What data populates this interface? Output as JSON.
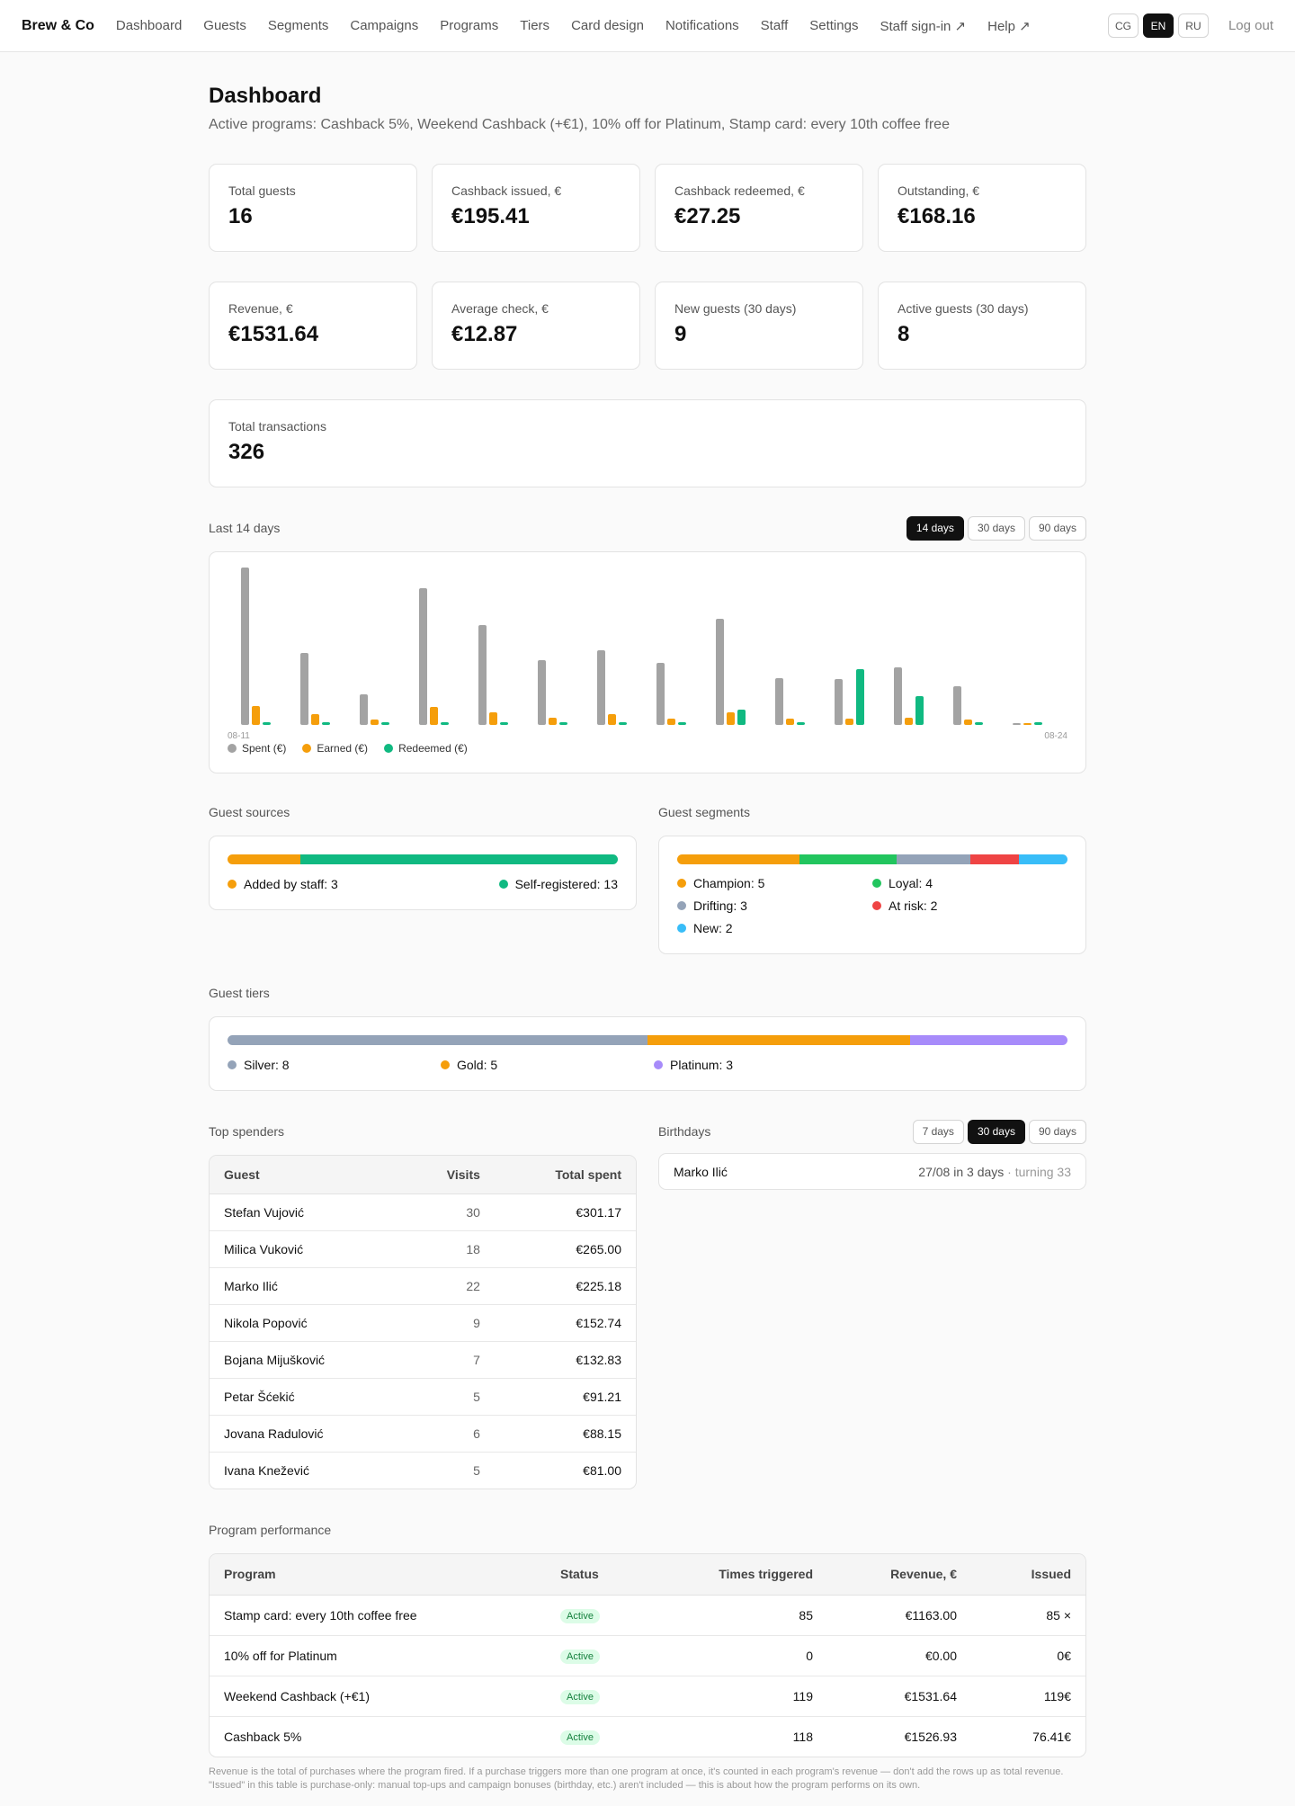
{
  "nav": {
    "brand": "Brew & Co",
    "items": [
      "Dashboard",
      "Guests",
      "Segments",
      "Campaigns",
      "Programs",
      "Tiers",
      "Card design",
      "Notifications",
      "Staff",
      "Settings",
      "Staff sign-in ↗",
      "Help ↗"
    ],
    "languages": [
      "CG",
      "EN",
      "RU"
    ],
    "active_language": "EN",
    "logout": "Log out"
  },
  "page": {
    "title": "Dashboard",
    "subtitle": "Active programs: Cashback 5%, Weekend Cashback (+€1), 10% off for Platinum, Stamp card: every 10th coffee free"
  },
  "stats": [
    {
      "label": "Total guests",
      "value": "16"
    },
    {
      "label": "Cashback issued, €",
      "value": "€195.41"
    },
    {
      "label": "Cashback redeemed, €",
      "value": "€27.25"
    },
    {
      "label": "Outstanding, €",
      "value": "€168.16"
    },
    {
      "label": "Revenue, €",
      "value": "€1531.64"
    },
    {
      "label": "Average check, €",
      "value": "€12.87"
    },
    {
      "label": "New guests (30 days)",
      "value": "9"
    },
    {
      "label": "Active guests (30 days)",
      "value": "8"
    },
    {
      "label": "Total transactions",
      "value": "326"
    }
  ],
  "chart": {
    "label": "Last 14 days",
    "ranges": [
      "14 days",
      "30 days",
      "90 days"
    ],
    "active_range": "14 days"
  },
  "chart_data": {
    "type": "bar",
    "x_tick_labels": [
      "08-11",
      "08-24"
    ],
    "categories": [
      "08-11",
      "08-12",
      "08-13",
      "08-14",
      "08-15",
      "08-16",
      "08-17",
      "08-18",
      "08-19",
      "08-20",
      "08-21",
      "08-22",
      "08-23",
      "08-24"
    ],
    "series": [
      {
        "name": "Spent (€)",
        "color": "#a3a3a3",
        "values": [
          175,
          80,
          34,
          152,
          111,
          72,
          83,
          69,
          118,
          52,
          51,
          64,
          43,
          2
        ]
      },
      {
        "name": "Earned (€)",
        "color": "#f59e0b",
        "values": [
          21,
          12,
          6,
          20,
          14,
          8,
          12,
          7,
          14,
          7,
          7,
          8,
          6,
          2
        ]
      },
      {
        "name": "Redeemed (€)",
        "color": "#10b981",
        "values": [
          3,
          3,
          3,
          3,
          3,
          3,
          3,
          3,
          17,
          3,
          62,
          32,
          3,
          3
        ]
      }
    ],
    "grid": false,
    "legend_position": "bottom-left"
  },
  "guest_sources": {
    "label": "Guest sources",
    "items": [
      {
        "label": "Added by staff: 3",
        "count": 3,
        "color": "#f59e0b"
      },
      {
        "label": "Self-registered: 13",
        "count": 13,
        "color": "#10b981"
      }
    ]
  },
  "guest_segments": {
    "label": "Guest segments",
    "items": [
      {
        "label": "Champion: 5",
        "count": 5,
        "color": "#f59e0b"
      },
      {
        "label": "Loyal: 4",
        "count": 4,
        "color": "#22c55e"
      },
      {
        "label": "Drifting: 3",
        "count": 3,
        "color": "#94a3b8"
      },
      {
        "label": "At risk: 2",
        "count": 2,
        "color": "#ef4444"
      },
      {
        "label": "New: 2",
        "count": 2,
        "color": "#38bdf8"
      }
    ]
  },
  "guest_tiers": {
    "label": "Guest tiers",
    "items": [
      {
        "label": "Silver: 8",
        "count": 8,
        "color": "#94a3b8"
      },
      {
        "label": "Gold: 5",
        "count": 5,
        "color": "#f59e0b"
      },
      {
        "label": "Platinum: 3",
        "count": 3,
        "color": "#a78bfa"
      }
    ]
  },
  "top_spenders": {
    "label": "Top spenders",
    "columns": [
      "Guest",
      "Visits",
      "Total spent"
    ],
    "rows": [
      [
        "Stefan Vujović",
        "30",
        "€301.17"
      ],
      [
        "Milica Vuković",
        "18",
        "€265.00"
      ],
      [
        "Marko Ilić",
        "22",
        "€225.18"
      ],
      [
        "Nikola Popović",
        "9",
        "€152.74"
      ],
      [
        "Bojana Mijušković",
        "7",
        "€132.83"
      ],
      [
        "Petar Šćekić",
        "5",
        "€91.21"
      ],
      [
        "Jovana Radulović",
        "6",
        "€88.15"
      ],
      [
        "Ivana Knežević",
        "5",
        "€81.00"
      ]
    ]
  },
  "birthdays": {
    "label": "Birthdays",
    "ranges": [
      "7 days",
      "30 days",
      "90 days"
    ],
    "active_range": "30 days",
    "items": [
      {
        "name": "Marko Ilić",
        "date": "27/08",
        "when": "in 3 days",
        "turning": "· turning 33"
      }
    ]
  },
  "program_performance": {
    "label": "Program performance",
    "columns": [
      "Program",
      "Status",
      "Times triggered",
      "Revenue, €",
      "Issued"
    ],
    "rows": [
      [
        "Stamp card: every 10th coffee free",
        "Active",
        "85",
        "€1163.00",
        "85 ×"
      ],
      [
        "10% off for Platinum",
        "Active",
        "0",
        "€0.00",
        "0€"
      ],
      [
        "Weekend Cashback (+€1)",
        "Active",
        "119",
        "€1531.64",
        "119€"
      ],
      [
        "Cashback 5%",
        "Active",
        "118",
        "€1526.93",
        "76.41€"
      ]
    ],
    "footnote": "Revenue is the total of purchases where the program fired. If a purchase triggers more than one program at once, it's counted in each program's revenue — don't add the rows up as total revenue. \"Issued\" in this table is purchase-only: manual top-ups and campaign bonuses (birthday, etc.) aren't included — this is about how the program performs on its own."
  }
}
